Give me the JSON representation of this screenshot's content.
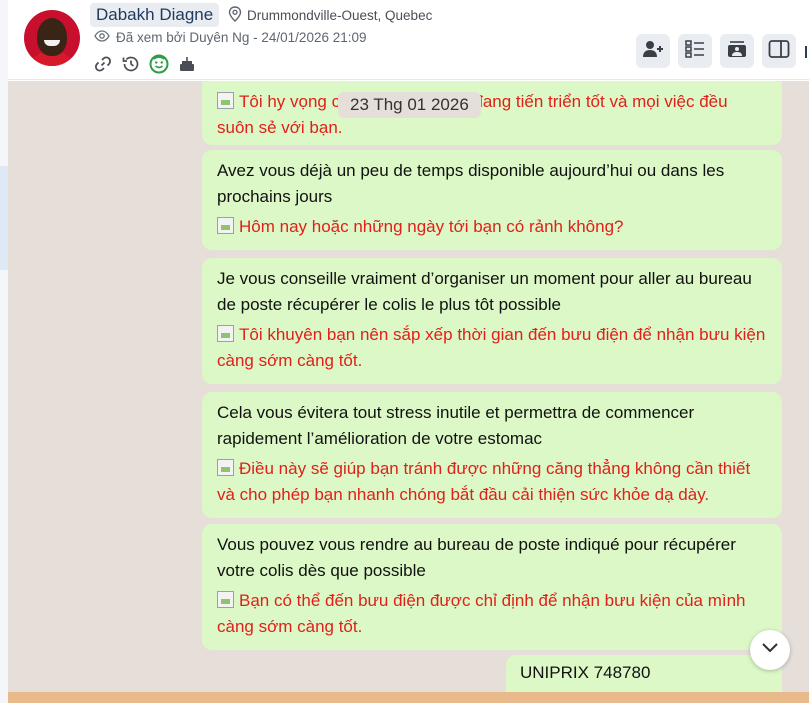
{
  "contact": {
    "name": "Dabakh Diagne",
    "location": "Drummondville-Ouest, Quebec",
    "seen_by": "Đã xem bởi Duyên Ng - 24/01/2026 21:09"
  },
  "icons": {
    "header_row": [
      "link-icon",
      "history-icon",
      "face-status-icon",
      "cake-icon"
    ],
    "toolbar": [
      "add-user-icon",
      "list-details-icon",
      "photo-stack-icon",
      "sidebar-panel-icon"
    ]
  },
  "chat": {
    "date_separator": "23 Thg 01 2026",
    "partial_message": {
      "vi": "Tôi hy vọng công việc của bạn đang tiến triển tốt và mọi việc đều suôn sẻ với bạn."
    },
    "messages": [
      {
        "fr": "Avez vous déjà un peu de temps disponible aujourd’hui ou dans les prochains jours",
        "vi": "Hôm nay hoặc những ngày tới bạn có rảnh không?"
      },
      {
        "fr": "Je vous conseille vraiment d’organiser un moment pour aller au bureau de poste récupérer le colis le plus tôt possible",
        "vi": "Tôi khuyên bạn nên sắp xếp thời gian đến bưu điện để nhận bưu kiện càng sớm càng tốt."
      },
      {
        "fr": "Cela vous évitera tout stress inutile et permettra de commencer rapidement l’amélioration de votre estomac",
        "vi": "Điều này sẽ giúp bạn tránh được những căng thẳng không cần thiết và cho phép bạn nhanh chóng bắt đầu cải thiện sức khỏe dạ dày."
      },
      {
        "fr": "Vous pouvez vous rendre au bureau de poste indiqué pour récupérer votre colis dès que possible",
        "vi": "Bạn có thể đến bưu điện được chỉ định để nhận bưu kiện của mình càng sớm càng tốt."
      }
    ],
    "last_message": "UNIPRIX 748780"
  },
  "colors": {
    "bubble_bg": "#dcf8c6",
    "chat_bg": "#e6ded8",
    "translation_text": "#e0201b",
    "name_text": "#1f3a5f"
  }
}
